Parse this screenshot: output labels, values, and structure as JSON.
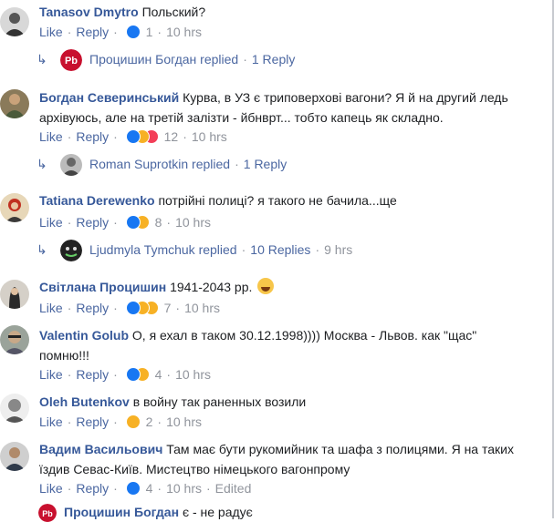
{
  "comments": [
    {
      "author": "Tanasov Dmytro",
      "text": "Польский?",
      "like": "Like",
      "reply": "Reply",
      "reactions": "1",
      "time": "10 hrs"
    },
    {
      "author": "Богдан Северинський",
      "text": "Курва, в УЗ є триповерхові вагони? Я й на другий ледь архівуюсь, але на третій залізти - йбнврт... тобто капець як складно.",
      "like": "Like",
      "reply": "Reply",
      "reactions": "12",
      "time": "10 hrs"
    },
    {
      "author": "Tatiana Derewenko",
      "text": "потрійні полиці? я такого не бачила...ще",
      "like": "Like",
      "reply": "Reply",
      "reactions": "8",
      "time": "10 hrs"
    },
    {
      "author": "Світлана Процишин",
      "text": "1941-2043 рр.",
      "like": "Like",
      "reply": "Reply",
      "reactions": "7",
      "time": "10 hrs"
    },
    {
      "author": "Valentin Golub",
      "text": "О, я ехал в таком 30.12.1998)))) Москва - Львов. как \"щас\" помню!!!",
      "like": "Like",
      "reply": "Reply",
      "reactions": "4",
      "time": "10 hrs"
    },
    {
      "author": "Oleh Butenkov",
      "text": "в войну так раненных возили",
      "like": "Like",
      "reply": "Reply",
      "reactions": "2",
      "time": "10 hrs"
    },
    {
      "author": "Вадим Васильович",
      "text": "Там має бути рукомийник та шафа з полицями. Я на таких їздив Севас-Київ. Мистецтво німецького вагонпрому",
      "like": "Like",
      "reply": "Reply",
      "reactions": "4",
      "time": "10 hrs",
      "edited": "Edited"
    }
  ],
  "replies": [
    {
      "name": "Процишин Богдан replied",
      "count": "1 Reply",
      "avatar_text": "Pb"
    },
    {
      "name": "Roman Suprotkin replied",
      "count": "1 Reply"
    },
    {
      "name": "Ljudmyla Tymchuk replied",
      "count": "10 Replies",
      "time": "9 hrs"
    }
  ],
  "partial": {
    "name": "Процишин Богдан",
    "text": "є - не радує",
    "avatar_text": "Pb"
  },
  "colors": {
    "link": "#365899",
    "meta": "#90949c",
    "action": "#4b67a1",
    "like": "#1877f2",
    "haha": "#f7b125",
    "love": "#f33e58",
    "pb": "#c8102e"
  }
}
